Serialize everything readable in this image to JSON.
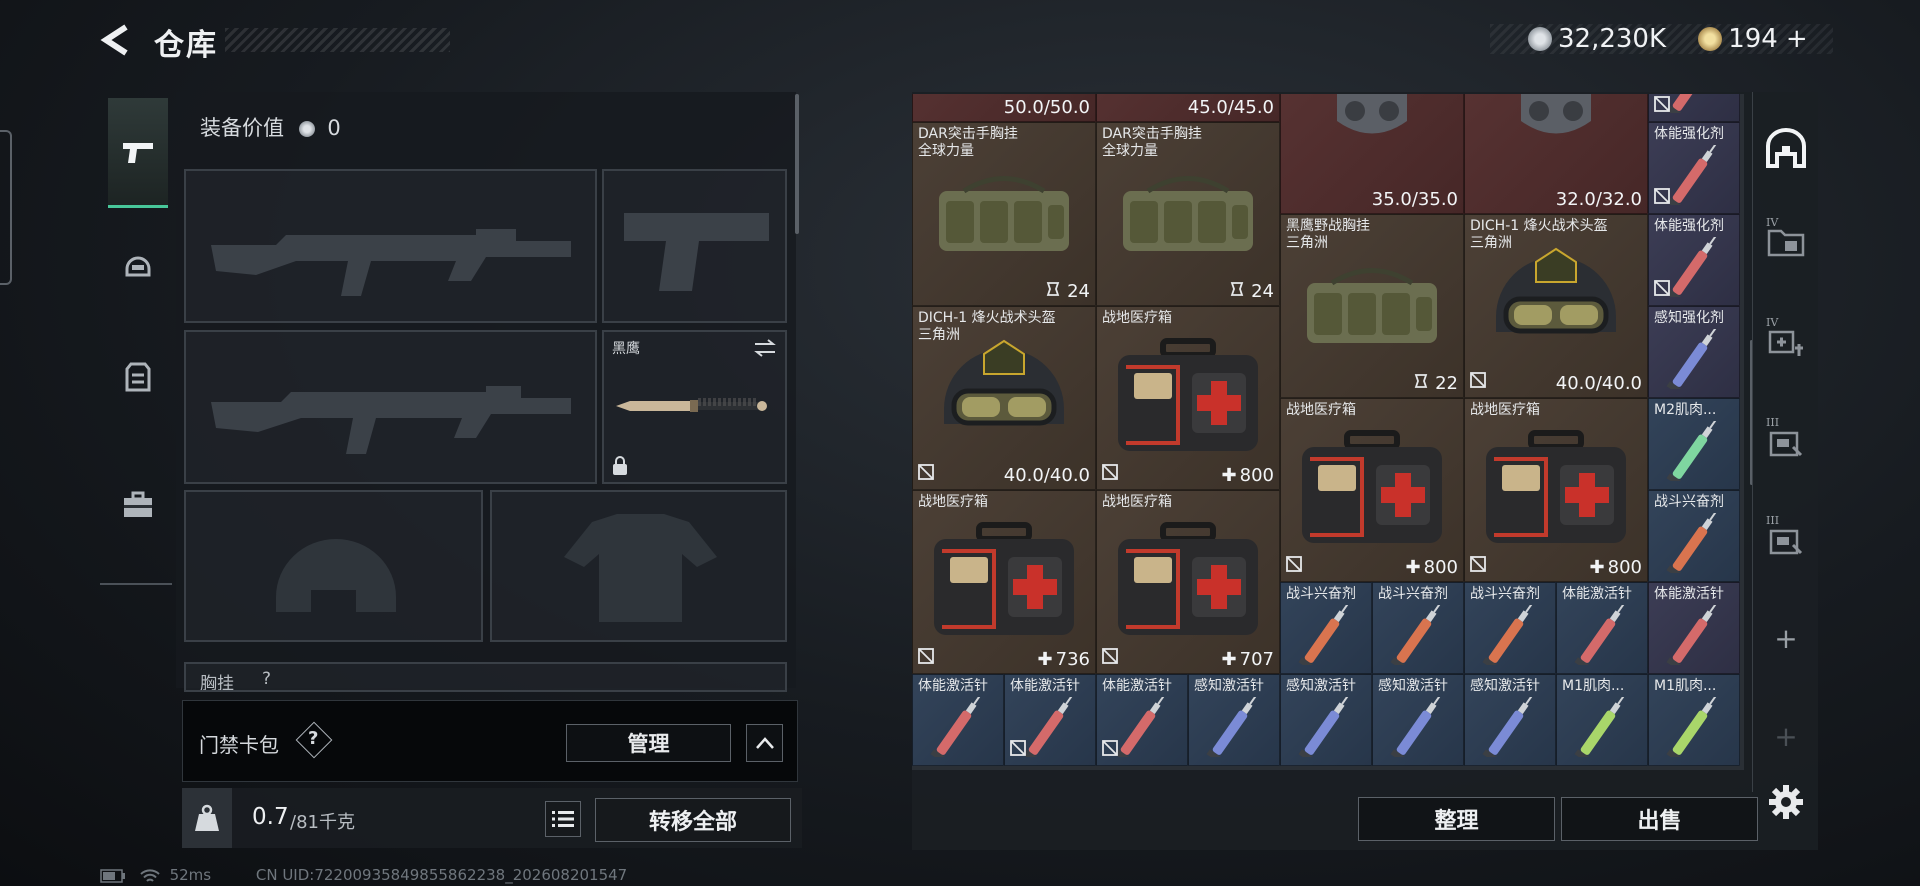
{
  "header": {
    "title": "仓库",
    "currency_1": "32,230K",
    "currency_2": "194",
    "currency_2_plus": "+"
  },
  "left_panel": {
    "equip_value_label": "装备价值",
    "equip_value": "0",
    "knife_label": "黑鹰",
    "chest_rig_label": "胸挂",
    "chest_rig_hint": "?",
    "key_case_label": "门禁卡包",
    "key_case_help": "?",
    "manage_button": "管理",
    "weight_current": "0.7",
    "weight_max": "/81千克",
    "transfer_all_button": "转移全部"
  },
  "stash": {
    "cells": [
      {
        "label": "",
        "value": "50.0/50.0",
        "bg": "red"
      },
      {
        "label": "",
        "value": "45.0/45.0",
        "bg": "red"
      },
      {
        "label": "DAR突击手胸挂\n全球力量",
        "value": "24",
        "bg": "brown",
        "icon": "chest-rig"
      },
      {
        "label": "DAR突击手胸挂\n全球力量",
        "value": "24",
        "bg": "brown",
        "icon": "chest-rig"
      },
      {
        "label": "",
        "value": "35.0/35.0",
        "bg": "red",
        "icon": "mask-helmet"
      },
      {
        "label": "",
        "value": "32.0/32.0",
        "bg": "red",
        "icon": "mask-helmet"
      },
      {
        "label": "黑鹰野战胸挂\n三角洲",
        "value": "22",
        "bg": "brown",
        "icon": "chest-rig"
      },
      {
        "label": "DICH-1 烽火战术头盔\n三角洲",
        "value": "40.0/40.0",
        "bg": "brown",
        "icon": "helmet"
      },
      {
        "label": "DICH-1 烽火战术头盔\n三角洲",
        "value": "40.0/40.0",
        "bg": "brown",
        "icon": "helmet"
      },
      {
        "label": "战地医疗箱",
        "value": "800",
        "bg": "brown",
        "icon": "medkit"
      },
      {
        "label": "战地医疗箱",
        "value": "800",
        "bg": "brown",
        "icon": "medkit"
      },
      {
        "label": "战地医疗箱",
        "value": "800",
        "bg": "brown",
        "icon": "medkit"
      },
      {
        "label": "战地医疗箱",
        "value": "736",
        "bg": "brown",
        "icon": "medkit"
      },
      {
        "label": "战地医疗箱",
        "value": "707",
        "bg": "brown",
        "icon": "medkit"
      }
    ],
    "right_column": [
      "体能强化剂",
      "体能强化剂",
      "感知强化剂",
      "M2肌肉...",
      "战斗兴奋剂",
      "体能激活针",
      "M1肌肉..."
    ],
    "row6": [
      "战斗兴奋剂",
      "战斗兴奋剂",
      "战斗兴奋剂",
      "体能激活针"
    ],
    "row7": [
      "体能激活针",
      "体能激活针",
      "体能激活针",
      "感知激活针",
      "感知激活针",
      "感知激活针",
      "感知激活针",
      "M1肌肉..."
    ]
  },
  "actions": {
    "sort_button": "整理",
    "sell_button": "出售"
  },
  "rail": {
    "tag_iv_1": "IV",
    "tag_iv_2": "IV",
    "tag_iii_1": "III",
    "tag_iii_2": "III",
    "plus_1": "+",
    "plus_2": "+"
  },
  "status": {
    "ping": "52ms",
    "uid": "CN UID:72200935849855862238_202608201547"
  },
  "colors": {
    "accent": "#48c79a",
    "brown_cell": "#4c4036",
    "red_cell": "#5a3434",
    "purple_cell": "#3c3d55",
    "blue_cell": "#33445a"
  }
}
